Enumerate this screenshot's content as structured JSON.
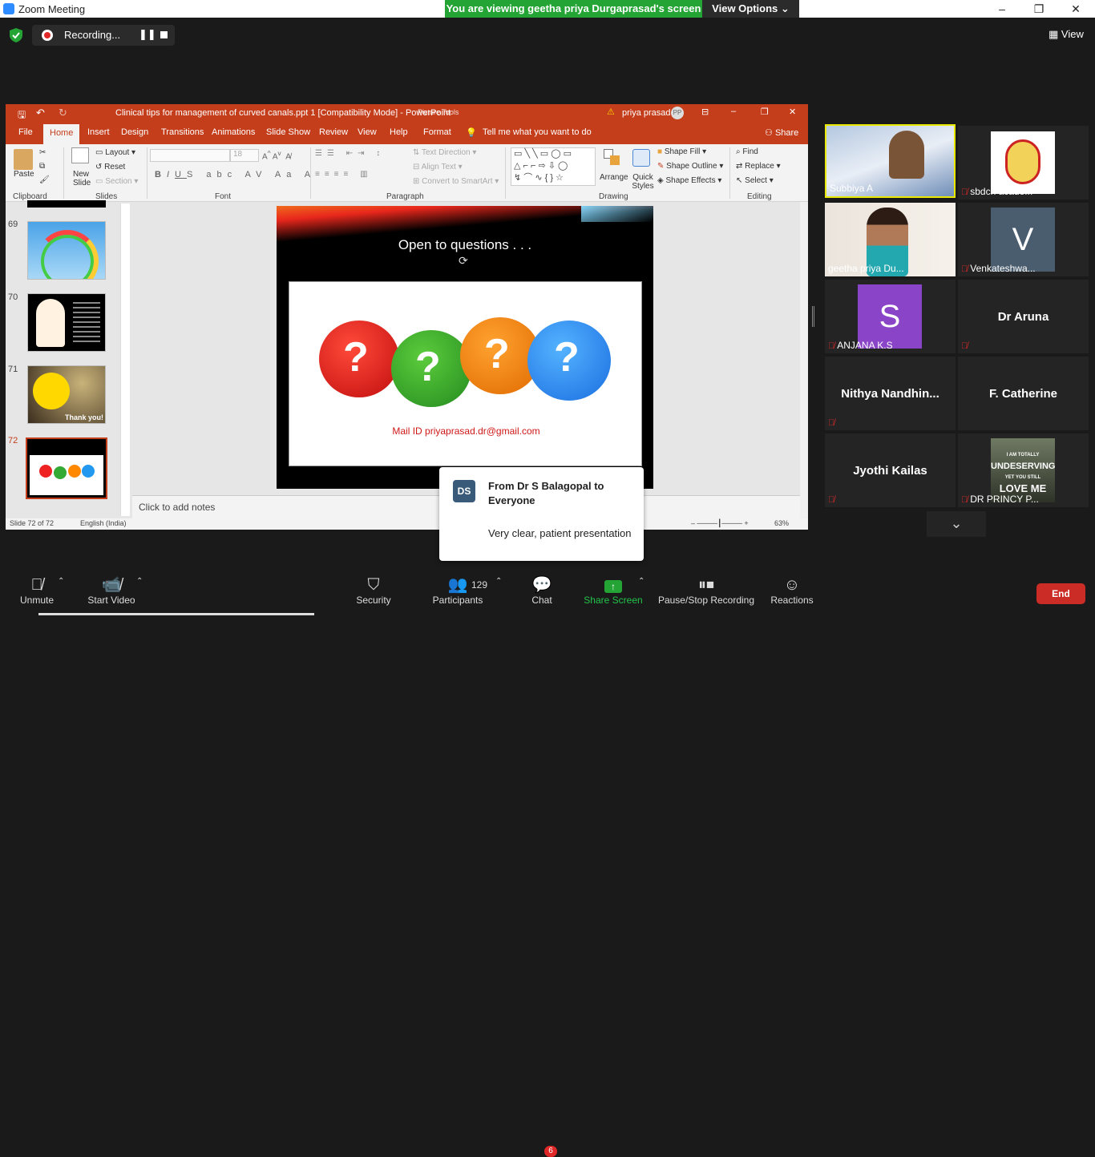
{
  "zoom": {
    "window_title": "Zoom Meeting",
    "viewing_banner": "You are viewing geetha priya Durgaprasad's screen",
    "view_options": "View Options",
    "recording_label": "Recording...",
    "view_label": "View",
    "minimize": "–",
    "restore": "❐",
    "close": "✕"
  },
  "ppt": {
    "title": "Clinical tips for management of curved canals.ppt 1 [Compatibility Mode]  -  PowerPoint",
    "picture_tools": "Picture Tools",
    "user": "priya prasad",
    "user_initials": "PP",
    "tabs": [
      "File",
      "Home",
      "Insert",
      "Design",
      "Transitions",
      "Animations",
      "Slide Show",
      "Review",
      "View",
      "Help",
      "Format"
    ],
    "tell_me": "Tell me what you want to do",
    "share": "Share",
    "ribbon": {
      "paste": "Paste",
      "new_slide": "New Slide",
      "layout": "Layout",
      "reset": "Reset",
      "section": "Section",
      "font_size": "18",
      "text_direction": "Text Direction",
      "align_text": "Align Text",
      "convert_smartart": "Convert to SmartArt",
      "arrange": "Arrange",
      "quick_styles": "Quick Styles",
      "shape_fill": "Shape Fill",
      "shape_outline": "Shape Outline",
      "shape_effects": "Shape Effects",
      "find": "Find",
      "replace": "Replace",
      "select": "Select",
      "groups": [
        "Clipboard",
        "Slides",
        "Font",
        "Paragraph",
        "Drawing",
        "Editing"
      ]
    },
    "thumbs": [
      {
        "num": "69",
        "caption": ""
      },
      {
        "num": "70",
        "caption": ""
      },
      {
        "num": "71",
        "caption": "Thank you!"
      },
      {
        "num": "72",
        "caption": ""
      }
    ],
    "slide": {
      "heading": "Open to questions . . .",
      "mail": "Mail ID priyaprasad.dr@gmail.com"
    },
    "notes_placeholder": "Click to add notes",
    "status_slide": "Slide 72 of 72",
    "status_lang": "English (India)",
    "zoom_pct": "63%"
  },
  "chat_popup": {
    "initials": "DS",
    "from": "From Dr S Balagopal to Everyone",
    "message": "Very clear, patient presentation"
  },
  "gallery": [
    {
      "name": "Subbiya A",
      "muted": false,
      "type": "video"
    },
    {
      "name": "sbdch acade...",
      "muted": true,
      "type": "logo"
    },
    {
      "name": "geetha priya Du...",
      "muted": false,
      "type": "video"
    },
    {
      "name": "Venkateshwa...",
      "muted": true,
      "type": "letter",
      "letter": "V"
    },
    {
      "name": "ANJANA K.S",
      "muted": true,
      "type": "letter",
      "letter": "S"
    },
    {
      "name": "Dr Aruna",
      "muted": true,
      "type": "text"
    },
    {
      "name": "Nithya  Nandhin...",
      "muted": true,
      "type": "text"
    },
    {
      "name": "F. Catherine",
      "muted": false,
      "type": "text"
    },
    {
      "name": "Jyothi Kailas",
      "muted": true,
      "type": "text"
    },
    {
      "name": "DR PRINCY P...",
      "muted": true,
      "type": "image",
      "overlay_lines": [
        "I AM TOTALLY",
        "UNDESERVING",
        "YET YOU STILL",
        "LOVE ME"
      ]
    }
  ],
  "toolbar": {
    "unmute": "Unmute",
    "start_video": "Start Video",
    "security": "Security",
    "participants": "Participants",
    "participants_count": "129",
    "chat": "Chat",
    "chat_badge": "6",
    "share_screen": "Share Screen",
    "pause_recording": "Pause/Stop Recording",
    "reactions": "Reactions",
    "end": "End"
  },
  "colors": {
    "ppt_accent": "#c43e1c",
    "zoom_green": "#23a434",
    "end_red": "#cc2c26",
    "active_speaker": "#e8e800"
  }
}
